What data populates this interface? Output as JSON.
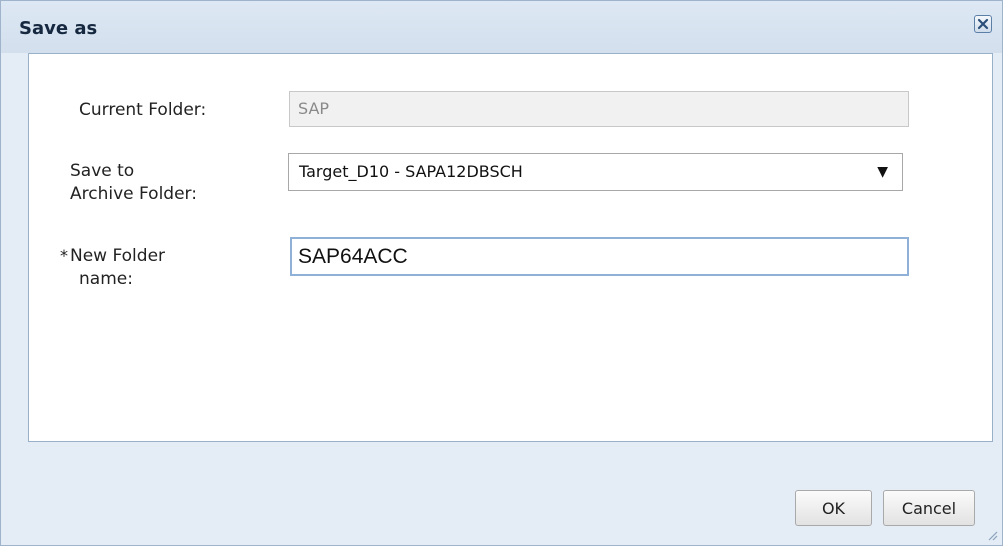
{
  "dialog": {
    "title": "Save as",
    "close_icon": "close-icon",
    "current_folder": {
      "label": "Current Folder:",
      "value": "SAP"
    },
    "archive_folder": {
      "label_line1": "Save to",
      "label_line2": "Archive Folder:",
      "selected": "Target_D10 - SAPA12DBSCH"
    },
    "new_folder": {
      "required_marker": "*",
      "label_line1": "New Folder",
      "label_line2": "name:",
      "value": "SAP64ACC"
    },
    "buttons": {
      "ok": "OK",
      "cancel": "Cancel"
    }
  }
}
